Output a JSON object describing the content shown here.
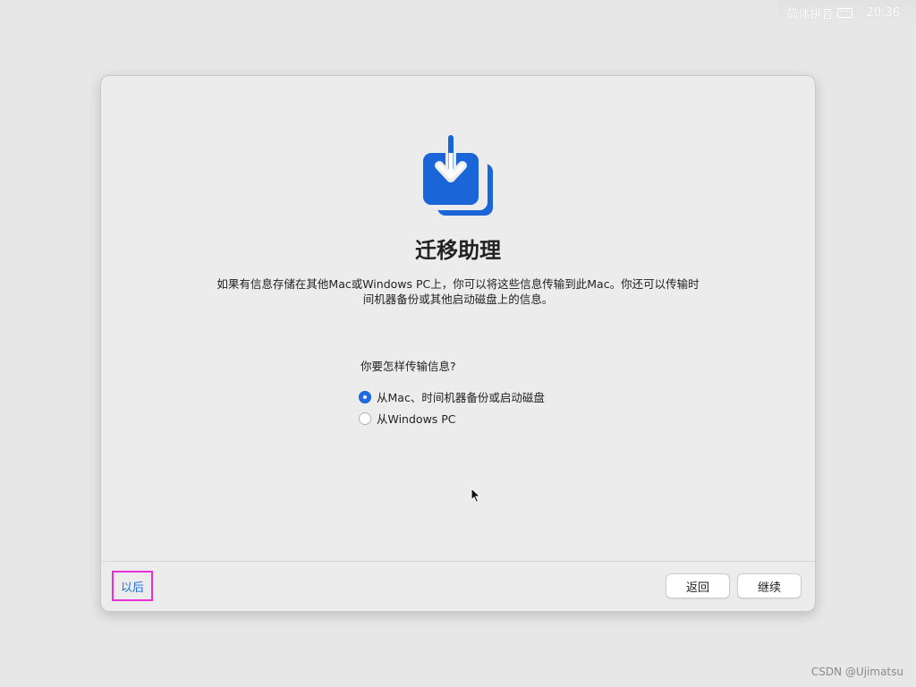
{
  "status_bar": {
    "input_method": "简体拼音",
    "time": "20:36",
    "keyboard_icon": "keyboard-icon"
  },
  "window": {
    "icon": "migration-download-icon",
    "title": "迁移助理",
    "description_line1": "如果有信息存储在其他Mac或Windows PC上，你可以将这些信息传输到此Mac。你还可以传输时",
    "description_line2": "间机器备份或其他启动磁盘上的信息。",
    "question": "你要怎样传输信息?",
    "options": [
      {
        "label": "从Mac、时间机器备份或启动磁盘",
        "selected": true
      },
      {
        "label": "从Windows PC",
        "selected": false
      }
    ],
    "footer": {
      "later_label": "以后",
      "back_label": "返回",
      "continue_label": "继续"
    }
  },
  "watermark": "CSDN @Ujimatsu",
  "colors": {
    "accent": "#1f6ce0",
    "highlight_border": "#e92fd8",
    "icon_blue": "#1a66d9"
  }
}
